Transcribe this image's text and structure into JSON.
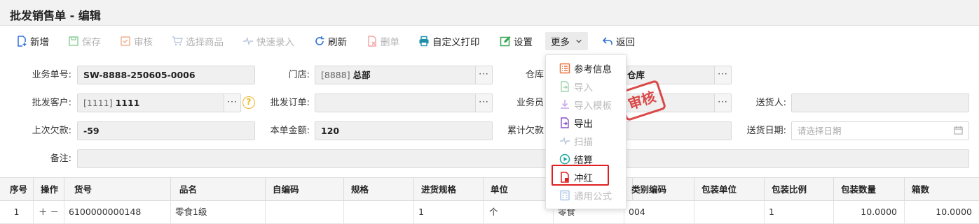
{
  "page": {
    "title": "批发销售单 - 编辑"
  },
  "toolbar": {
    "add": "新增",
    "save": "保存",
    "audit": "审核",
    "select_goods": "选择商品",
    "quick_entry": "快速录入",
    "refresh": "刷新",
    "delete": "删单",
    "custom_print": "自定义打印",
    "settings": "设置",
    "more": "更多",
    "back": "返回"
  },
  "form": {
    "order_no_label": "业务单号:",
    "order_no": "SW-8888-250605-0006",
    "store_label": "门店:",
    "store_code": "[8888]",
    "store_name": "总部",
    "warehouse_label": "仓库",
    "warehouse_name": "仓库",
    "customer_label": "批发客户:",
    "customer_code": "[1111]",
    "customer_name": "1111",
    "wholesale_order_label": "批发订单:",
    "salesman_label": "业务员",
    "deliverer_label": "送货人:",
    "last_debt_label": "上次欠款:",
    "last_debt": "-59",
    "amount_label": "本单金额:",
    "amount": "120",
    "total_debt_label": "累计欠款",
    "delivery_date_label": "送货日期:",
    "delivery_date_placeholder": "请选择日期",
    "remark_label": "备注:"
  },
  "stamp": {
    "text": "审核"
  },
  "table": {
    "headers": [
      "序号",
      "操作",
      "货号",
      "品名",
      "自编码",
      "规格",
      "进货规格",
      "单位",
      "类别编码",
      "包装单位",
      "包装比例",
      "包装数量",
      "箱数"
    ],
    "rows": [
      {
        "seq": "1",
        "ops": "＋ －",
        "sku": "6100000000148",
        "name": "零食1级",
        "self_code": "",
        "spec": "",
        "purchase_spec": "1",
        "unit": "个",
        "category_name": "零食",
        "category_code": "004",
        "pack_unit": "",
        "pack_ratio": "1",
        "pack_qty": "10.0000",
        "boxes": "10.0000"
      }
    ]
  },
  "more_menu": {
    "items": [
      {
        "label": "参考信息",
        "enabled": true,
        "icon": "info-list-icon"
      },
      {
        "label": "导入",
        "enabled": false,
        "icon": "import-icon"
      },
      {
        "label": "导入模板",
        "enabled": false,
        "icon": "download-template-icon"
      },
      {
        "label": "导出",
        "enabled": true,
        "icon": "export-icon"
      },
      {
        "label": "扫描",
        "enabled": false,
        "icon": "scan-icon"
      },
      {
        "label": "结算",
        "enabled": true,
        "icon": "settle-icon"
      },
      {
        "label": "冲红",
        "enabled": true,
        "icon": "reverse-icon"
      },
      {
        "label": "通用公式",
        "enabled": false,
        "icon": "formula-icon"
      }
    ]
  },
  "colors": {
    "accent": "#2f6fd6",
    "red": "#e02020",
    "orange": "#e8703a",
    "green": "#3aa655",
    "purple": "#8a4fc7"
  }
}
